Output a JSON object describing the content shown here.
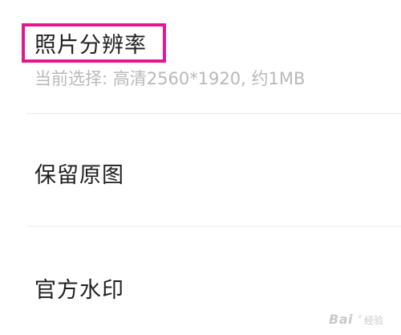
{
  "settings": {
    "resolution": {
      "title": "照片分辨率",
      "current_selection": "当前选择: 高清2560*1920, 约1MB",
      "highlighted": true,
      "highlight_color": "#e2188f"
    },
    "keep_original": {
      "title": "保留原图"
    },
    "official_watermark": {
      "title": "官方水印"
    }
  },
  "watermark": {
    "brand": "Bai",
    "suffix": "经验",
    "icon": "paw-icon"
  },
  "colors": {
    "title_text": "#1f1f1f",
    "subtitle_text": "#b9b9b9",
    "divider": "#ececec",
    "background": "#ffffff"
  }
}
